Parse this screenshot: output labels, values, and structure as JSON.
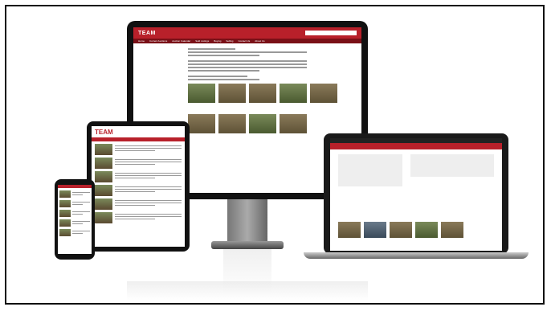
{
  "monitor": {
    "logo": "TEAM",
    "nav": [
      "Home",
      "Current Auctions",
      "Auction Calendar",
      "Sold Listings",
      "Buying",
      "Selling",
      "Contact Us",
      "About Us"
    ]
  },
  "tablet": {
    "logo": "TEAM"
  },
  "laptop": {
    "header": ""
  }
}
